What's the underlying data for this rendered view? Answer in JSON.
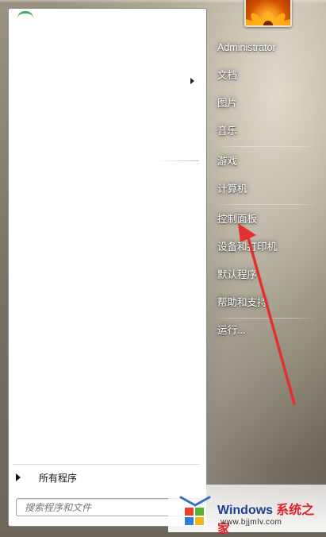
{
  "start_menu": {
    "left_panel": {
      "all_programs_label": "所有程序",
      "search_placeholder": "搜索程序和文件"
    },
    "right_panel": {
      "items": [
        {
          "label": "Administrator",
          "name": "user-name"
        },
        {
          "label": "文档",
          "name": "menu-documents"
        },
        {
          "label": "图片",
          "name": "menu-pictures"
        },
        {
          "label": "音乐",
          "name": "menu-music"
        },
        {
          "label": "游戏",
          "name": "menu-games"
        },
        {
          "label": "计算机",
          "name": "menu-computer"
        },
        {
          "label": "控制面板",
          "name": "menu-control-panel"
        },
        {
          "label": "设备和打印机",
          "name": "menu-devices-printers"
        },
        {
          "label": "默认程序",
          "name": "menu-default-programs"
        },
        {
          "label": "帮助和支持",
          "name": "menu-help-support"
        },
        {
          "label": "运行...",
          "name": "menu-run"
        }
      ]
    },
    "annotation": {
      "color": "#e23030",
      "points_to": "控制面板"
    }
  },
  "watermark": {
    "brand": "Windows",
    "brand_cn": "系统之家",
    "url": "www.bjjmlv.com"
  },
  "colors": {
    "panel_bg": "#ffffff",
    "glass_base": "#7a7262",
    "menu_text": "#ffffff",
    "brand_blue": "#1d3f8f",
    "brand_red": "#e2222b"
  }
}
